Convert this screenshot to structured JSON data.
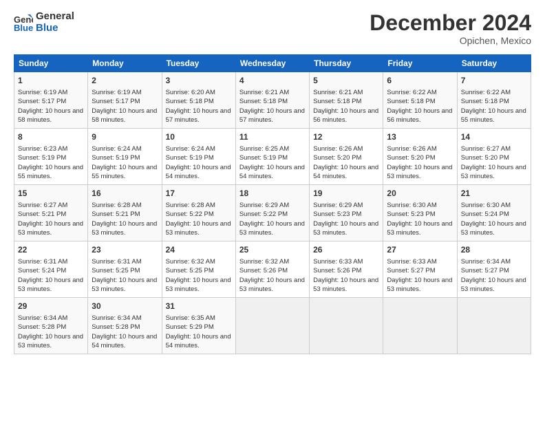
{
  "logo": {
    "line1": "General",
    "line2": "Blue"
  },
  "title": "December 2024",
  "subtitle": "Opichen, Mexico",
  "headers": [
    "Sunday",
    "Monday",
    "Tuesday",
    "Wednesday",
    "Thursday",
    "Friday",
    "Saturday"
  ],
  "weeks": [
    [
      {
        "day": "1",
        "rise": "6:19 AM",
        "set": "5:17 PM",
        "daylight": "10 hours and 58 minutes."
      },
      {
        "day": "2",
        "rise": "6:19 AM",
        "set": "5:17 PM",
        "daylight": "10 hours and 58 minutes."
      },
      {
        "day": "3",
        "rise": "6:20 AM",
        "set": "5:18 PM",
        "daylight": "10 hours and 57 minutes."
      },
      {
        "day": "4",
        "rise": "6:21 AM",
        "set": "5:18 PM",
        "daylight": "10 hours and 57 minutes."
      },
      {
        "day": "5",
        "rise": "6:21 AM",
        "set": "5:18 PM",
        "daylight": "10 hours and 56 minutes."
      },
      {
        "day": "6",
        "rise": "6:22 AM",
        "set": "5:18 PM",
        "daylight": "10 hours and 56 minutes."
      },
      {
        "day": "7",
        "rise": "6:22 AM",
        "set": "5:18 PM",
        "daylight": "10 hours and 55 minutes."
      }
    ],
    [
      {
        "day": "8",
        "rise": "6:23 AM",
        "set": "5:19 PM",
        "daylight": "10 hours and 55 minutes."
      },
      {
        "day": "9",
        "rise": "6:24 AM",
        "set": "5:19 PM",
        "daylight": "10 hours and 55 minutes."
      },
      {
        "day": "10",
        "rise": "6:24 AM",
        "set": "5:19 PM",
        "daylight": "10 hours and 54 minutes."
      },
      {
        "day": "11",
        "rise": "6:25 AM",
        "set": "5:19 PM",
        "daylight": "10 hours and 54 minutes."
      },
      {
        "day": "12",
        "rise": "6:26 AM",
        "set": "5:20 PM",
        "daylight": "10 hours and 54 minutes."
      },
      {
        "day": "13",
        "rise": "6:26 AM",
        "set": "5:20 PM",
        "daylight": "10 hours and 53 minutes."
      },
      {
        "day": "14",
        "rise": "6:27 AM",
        "set": "5:20 PM",
        "daylight": "10 hours and 53 minutes."
      }
    ],
    [
      {
        "day": "15",
        "rise": "6:27 AM",
        "set": "5:21 PM",
        "daylight": "10 hours and 53 minutes."
      },
      {
        "day": "16",
        "rise": "6:28 AM",
        "set": "5:21 PM",
        "daylight": "10 hours and 53 minutes."
      },
      {
        "day": "17",
        "rise": "6:28 AM",
        "set": "5:22 PM",
        "daylight": "10 hours and 53 minutes."
      },
      {
        "day": "18",
        "rise": "6:29 AM",
        "set": "5:22 PM",
        "daylight": "10 hours and 53 minutes."
      },
      {
        "day": "19",
        "rise": "6:29 AM",
        "set": "5:23 PM",
        "daylight": "10 hours and 53 minutes."
      },
      {
        "day": "20",
        "rise": "6:30 AM",
        "set": "5:23 PM",
        "daylight": "10 hours and 53 minutes."
      },
      {
        "day": "21",
        "rise": "6:30 AM",
        "set": "5:24 PM",
        "daylight": "10 hours and 53 minutes."
      }
    ],
    [
      {
        "day": "22",
        "rise": "6:31 AM",
        "set": "5:24 PM",
        "daylight": "10 hours and 53 minutes."
      },
      {
        "day": "23",
        "rise": "6:31 AM",
        "set": "5:25 PM",
        "daylight": "10 hours and 53 minutes."
      },
      {
        "day": "24",
        "rise": "6:32 AM",
        "set": "5:25 PM",
        "daylight": "10 hours and 53 minutes."
      },
      {
        "day": "25",
        "rise": "6:32 AM",
        "set": "5:26 PM",
        "daylight": "10 hours and 53 minutes."
      },
      {
        "day": "26",
        "rise": "6:33 AM",
        "set": "5:26 PM",
        "daylight": "10 hours and 53 minutes."
      },
      {
        "day": "27",
        "rise": "6:33 AM",
        "set": "5:27 PM",
        "daylight": "10 hours and 53 minutes."
      },
      {
        "day": "28",
        "rise": "6:34 AM",
        "set": "5:27 PM",
        "daylight": "10 hours and 53 minutes."
      }
    ],
    [
      {
        "day": "29",
        "rise": "6:34 AM",
        "set": "5:28 PM",
        "daylight": "10 hours and 53 minutes."
      },
      {
        "day": "30",
        "rise": "6:34 AM",
        "set": "5:28 PM",
        "daylight": "10 hours and 54 minutes."
      },
      {
        "day": "31",
        "rise": "6:35 AM",
        "set": "5:29 PM",
        "daylight": "10 hours and 54 minutes."
      },
      null,
      null,
      null,
      null
    ]
  ]
}
